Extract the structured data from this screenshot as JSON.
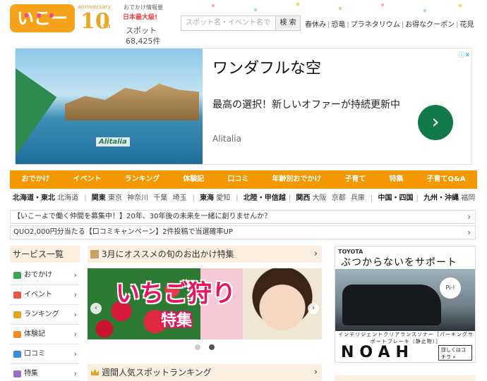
{
  "header": {
    "logo_text": "いこーよ",
    "anniversary_small": "anniversary",
    "anniversary_big": "10",
    "anniversary_th": "th",
    "tagline_top": "おでかけ情報量",
    "tagline_main": "日本最大級!",
    "spot_label": "スポット",
    "spot_count": "68,425件",
    "search_placeholder": "スポット名・イベント名で",
    "search_button": "検 索",
    "quick_links": [
      "春休み",
      "恐竜",
      "プラネタリウム",
      "お得なクーポン",
      "花見"
    ]
  },
  "ad": {
    "close_icon": "ⓘ✕",
    "logo": "Alitalia",
    "title": "ワンダフルな空",
    "description": "最高の選択！新しいオファーが持続更新中",
    "brand": "Alitalia",
    "arrow": "›"
  },
  "nav": {
    "items": [
      "おでかけ",
      "イベント",
      "ランキング",
      "体験記",
      "口コミ",
      "年齢別おでかけ",
      "子育て",
      "特集",
      "子育てQ&A"
    ]
  },
  "regions": [
    {
      "name": "北海道・東北",
      "subs": [
        "北海道"
      ]
    },
    {
      "name": "関東",
      "subs": [
        "東京",
        "神奈川",
        "千葉",
        "埼玉"
      ]
    },
    {
      "name": "東海",
      "subs": [
        "愛知"
      ]
    },
    {
      "name": "北陸・甲信越",
      "subs": []
    },
    {
      "name": "関西",
      "subs": [
        "大阪",
        "京都",
        "兵庫"
      ]
    },
    {
      "name": "中国・四国",
      "subs": []
    },
    {
      "name": "九州・沖縄",
      "subs": [
        "福岡"
      ]
    }
  ],
  "notices": [
    {
      "text": "【いこーよで働く仲間を募集中！】20年、30年後の未来を一緒に創りませんか？"
    },
    {
      "text": "QUO2,000円分当たる【口コミキャンペーン】2件投稿で当選確率UP"
    }
  ],
  "sidebar": {
    "title": "サービス一覧",
    "items": [
      {
        "label": "おでかけ",
        "icon": "bar-chart-icon",
        "color": "#3aa655"
      },
      {
        "label": "イベント",
        "icon": "flag-icon",
        "color": "#e8584a"
      },
      {
        "label": "ランキング",
        "icon": "crown-icon",
        "color": "#e2a523"
      },
      {
        "label": "体験記",
        "icon": "notebook-icon",
        "color": "#f08c2c"
      },
      {
        "label": "口コミ",
        "icon": "speech-bubble-icon",
        "color": "#3b8fd9"
      },
      {
        "label": "特集",
        "icon": "book-icon",
        "color": "#9b6fc7"
      }
    ]
  },
  "feature": {
    "heading": "3月にオススメの旬のお出かけ特集",
    "slide_title": "いちご狩り",
    "slide_subtitle": "特集",
    "prev": "‹",
    "next": "›"
  },
  "ranking": {
    "heading": "週間人気スポットランキング"
  },
  "side_ad": {
    "brand": "TOYOTA",
    "title": "ぶつからないをサポート",
    "bubble": "Pi-!",
    "tagline": "インテリジェントクリアランスソナー［パーキングサポートブレーキ（静止物）］",
    "model": "NOAH",
    "button": "詳しくはコチラ »"
  }
}
